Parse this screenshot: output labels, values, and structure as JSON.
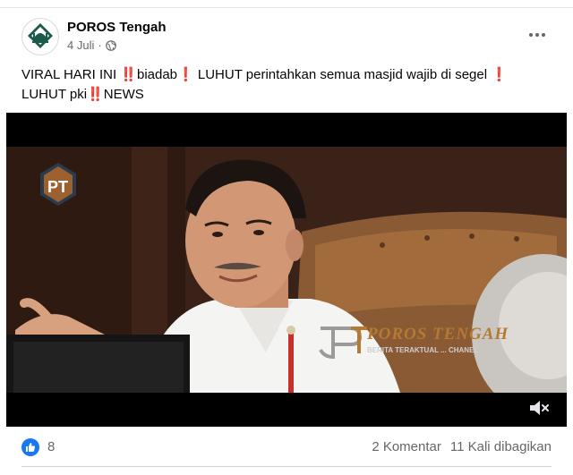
{
  "post": {
    "page_name": "POROS Tengah",
    "date": "4 Juli",
    "separator": "·",
    "visibility_icon": "globe-icon",
    "text_line1": "VIRAL HARI INI ‼️biadab❗ LUHUT perintahkan semua masjid wajib di segel ❗",
    "text_line2": "LUHUT pki‼️NEWS"
  },
  "video": {
    "watermark_title": "POROS TENGAH",
    "watermark_subtitle": "BERITA TERAKTUAL ... CHANEL",
    "logo_text": "PT",
    "mute_icon": "muted-speaker-icon"
  },
  "stats": {
    "reaction_icon": "like-icon",
    "likes": "8",
    "comments": "2 Komentar",
    "shares": "11 Kali dibagikan"
  },
  "colors": {
    "accent": "#1877f2",
    "secondary_text": "#65676b",
    "watermark": "#b57a32"
  }
}
